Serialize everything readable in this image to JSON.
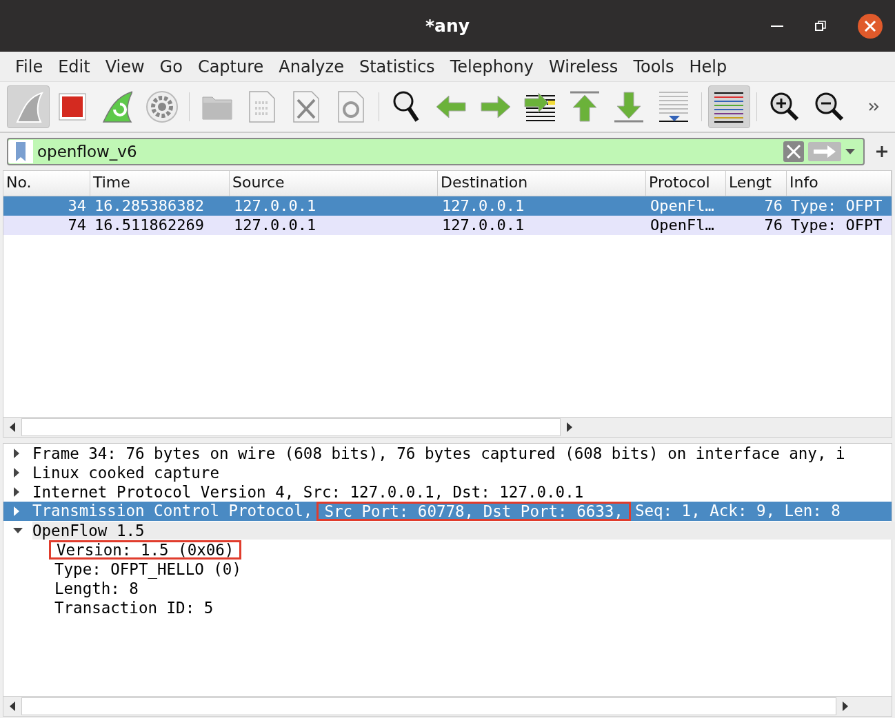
{
  "window": {
    "title": "*any"
  },
  "menu": [
    "File",
    "Edit",
    "View",
    "Go",
    "Capture",
    "Analyze",
    "Statistics",
    "Telephony",
    "Wireless",
    "Tools",
    "Help"
  ],
  "toolbar": [
    {
      "kind": "start",
      "selected": true
    },
    {
      "kind": "stop",
      "selected": false
    },
    {
      "kind": "restart",
      "selected": false
    },
    {
      "kind": "options",
      "selected": false
    },
    {
      "kind": "separator"
    },
    {
      "kind": "open",
      "selected": false
    },
    {
      "kind": "save",
      "selected": false
    },
    {
      "kind": "close",
      "selected": false
    },
    {
      "kind": "reload",
      "selected": false
    },
    {
      "kind": "separator"
    },
    {
      "kind": "find",
      "selected": false
    },
    {
      "kind": "back",
      "selected": false
    },
    {
      "kind": "forward",
      "selected": false
    },
    {
      "kind": "goto",
      "selected": false
    },
    {
      "kind": "first",
      "selected": false
    },
    {
      "kind": "last",
      "selected": false
    },
    {
      "kind": "autoscroll",
      "selected": false
    },
    {
      "kind": "separator"
    },
    {
      "kind": "colorize",
      "selected": true
    },
    {
      "kind": "separator"
    },
    {
      "kind": "zoom-in",
      "selected": false
    },
    {
      "kind": "zoom-out",
      "selected": false
    },
    {
      "kind": "more",
      "selected": false
    }
  ],
  "filter": {
    "value": "openflow_v6"
  },
  "packet_list": {
    "columns": [
      "No.",
      "Time",
      "Source",
      "Destination",
      "Protocol",
      "Lengt",
      "Info"
    ],
    "rows": [
      {
        "selected": true,
        "cells": [
          "34",
          "16.285386382",
          "127.0.0.1",
          "127.0.0.1",
          "OpenFl…",
          "76",
          "Type: OFPT"
        ]
      },
      {
        "selected": false,
        "cells": [
          "74",
          "16.511862269",
          "127.0.0.1",
          "127.0.0.1",
          "OpenFl…",
          "76",
          "Type: OFPT"
        ]
      }
    ]
  },
  "details": [
    {
      "expanded": false,
      "selected": false,
      "segments": [
        {
          "text": "Frame 34: 76 bytes on wire (608 bits), 76 bytes captured (608 bits) on interface any, i",
          "boxed": false
        }
      ]
    },
    {
      "expanded": false,
      "selected": false,
      "segments": [
        {
          "text": "Linux cooked capture",
          "boxed": false
        }
      ]
    },
    {
      "expanded": false,
      "selected": false,
      "segments": [
        {
          "text": "Internet Protocol Version 4, Src: 127.0.0.1, Dst: 127.0.0.1",
          "boxed": false
        }
      ]
    },
    {
      "expanded": false,
      "selected": true,
      "segments": [
        {
          "text": "Transmission Control Protocol,",
          "boxed": false
        },
        {
          "text": "Src Port: 60778, Dst Port: 6633,",
          "boxed": true
        },
        {
          "text": "Seq: 1, Ack: 9, Len: 8",
          "boxed": false
        }
      ]
    },
    {
      "expanded": true,
      "selected": false,
      "segments": [
        {
          "text": "OpenFlow 1.5",
          "boxed": false
        }
      ],
      "children": [
        {
          "segments": [
            {
              "text": "Version: 1.5 (0x06)",
              "boxed": true
            }
          ]
        },
        {
          "segments": [
            {
              "text": "Type: OFPT_HELLO (0)",
              "boxed": false
            }
          ]
        },
        {
          "segments": [
            {
              "text": "Length: 8",
              "boxed": false
            }
          ]
        },
        {
          "segments": [
            {
              "text": "Transaction ID: 5",
              "boxed": false
            }
          ]
        }
      ]
    }
  ]
}
